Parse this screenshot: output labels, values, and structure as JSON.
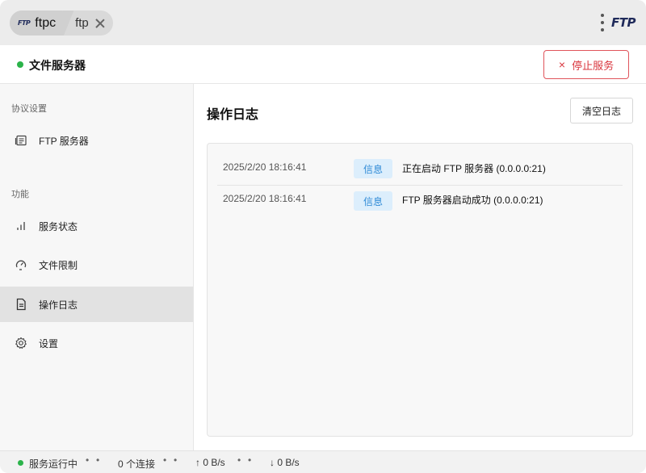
{
  "titlebar": {
    "app_icon_text": "FTP",
    "tabs": [
      {
        "label": "ftpc"
      },
      {
        "label": "ftp"
      }
    ],
    "brand": "FTP"
  },
  "header": {
    "title": "文件服务器",
    "status_color": "#2bb34a",
    "stop_icon": "×",
    "stop_label": "停止服务"
  },
  "sidebar": {
    "sections": [
      {
        "title": "协议设置"
      },
      {
        "title": "功能"
      }
    ],
    "items": [
      {
        "label": "FTP 服务器",
        "icon": "server-icon"
      },
      {
        "label": "服务状态",
        "icon": "bar-chart-icon"
      },
      {
        "label": "文件限制",
        "icon": "speed-limit-icon"
      },
      {
        "label": "操作日志",
        "icon": "document-icon",
        "active": true
      },
      {
        "label": "设置",
        "icon": "gear-icon"
      }
    ]
  },
  "main": {
    "title": "操作日志",
    "clear_label": "清空日志",
    "logs": [
      {
        "time": "2025/2/20 18:16:41",
        "level": "信息",
        "message": "正在启动 FTP 服务器 (0.0.0.0:21)"
      },
      {
        "time": "2025/2/20 18:16:41",
        "level": "信息",
        "message": "FTP 服务器启动成功 (0.0.0.0:21)"
      }
    ]
  },
  "statusbar": {
    "running": "服务运行中",
    "separator": "•",
    "connections": "0 个连接",
    "upload": "↑ 0 B/s",
    "download": "↓ 0 B/s"
  },
  "colors": {
    "accent_danger": "#d9363e",
    "status_green": "#2bb34a",
    "badge_bg": "#dceefc",
    "badge_text": "#2f8ad6"
  }
}
